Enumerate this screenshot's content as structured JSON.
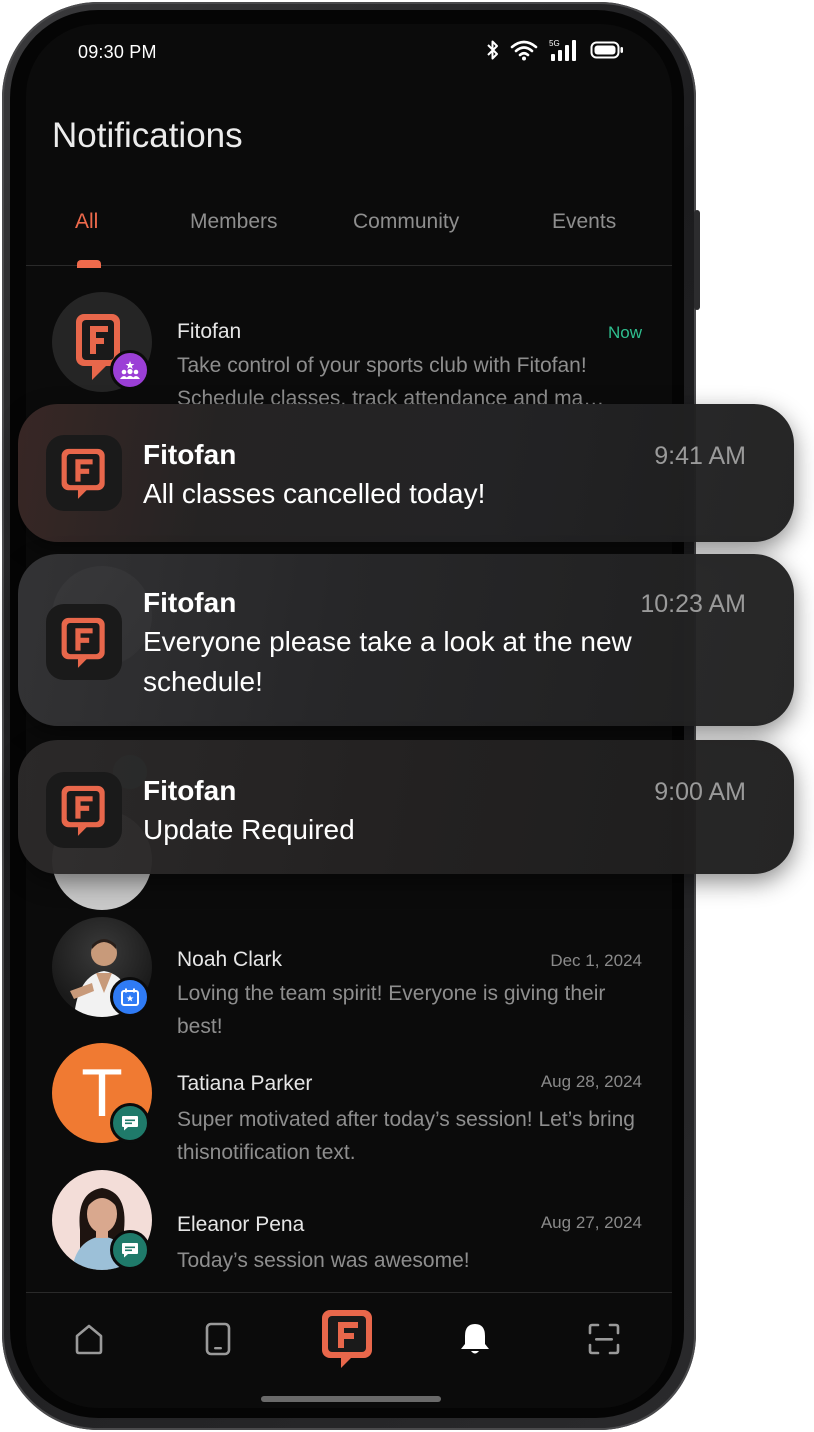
{
  "status_bar": {
    "time": "09:30 PM"
  },
  "page": {
    "title": "Notifications"
  },
  "tabs": [
    {
      "label": "All",
      "active": true
    },
    {
      "label": "Members",
      "active": false
    },
    {
      "label": "Community",
      "active": false
    },
    {
      "label": "Events",
      "active": false
    }
  ],
  "list": {
    "items": [
      {
        "name": "Fitofan",
        "time": "Now",
        "message": "Take control of your sports club with Fitofan! Schedule classes, track attendance and ma…",
        "badge": "members-icon"
      },
      {
        "name": "Noah Clark",
        "time": "Dec 1, 2024",
        "message": "Loving the team spirit! Everyone is giving their best!",
        "badge": "calendar-star-icon"
      },
      {
        "name": "Tatiana Parker",
        "time": "Aug 28, 2024",
        "message": "Super motivated after today’s session! Let’s bring thisnotification text.",
        "badge": "chat-icon",
        "initial": "T"
      },
      {
        "name": "Eleanor Pena",
        "time": "Aug 27, 2024",
        "message": "Today’s session was awesome!",
        "badge": "chat-icon"
      }
    ]
  },
  "notifications": [
    {
      "app": "Fitofan",
      "time": "9:41 AM",
      "body": "All classes cancelled today!"
    },
    {
      "app": "Fitofan",
      "time": "10:23 AM",
      "body": "Everyone please take a look at the new schedule!"
    },
    {
      "app": "Fitofan",
      "time": "9:00 AM",
      "body": "Update Required"
    }
  ],
  "bottom_nav": [
    "home-icon",
    "device-icon",
    "fitofan-logo",
    "bell-icon",
    "scan-icon"
  ],
  "colors": {
    "accent": "#ef6a4c",
    "now": "#2fbf8f",
    "badge_purple": "#9b3fd6",
    "badge_blue": "#2f7bf5",
    "badge_teal": "#1f7a6a",
    "avatar_orange": "#f07a32"
  }
}
